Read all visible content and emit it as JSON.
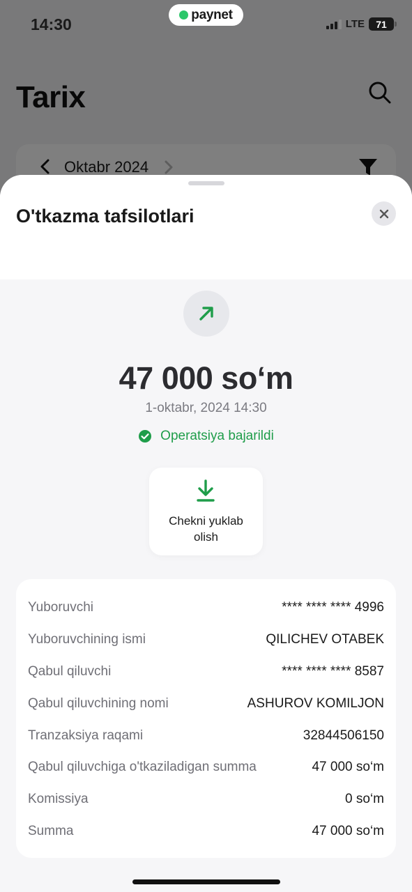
{
  "status_bar": {
    "time": "14:30",
    "brand": "paynet",
    "network": "LTE",
    "battery": "71"
  },
  "background_page": {
    "title": "Tarix",
    "month": "Oktabr 2024"
  },
  "sheet": {
    "title": "O'tkazma tafsilotlari",
    "amount": "47 000 so‘m",
    "datetime": "1-oktabr, 2024 14:30",
    "status": "Operatsiya bajarildi",
    "download_label": "Chekni yuklab olish",
    "details": [
      {
        "label": "Yuboruvchi",
        "value": "**** **** **** 4996"
      },
      {
        "label": "Yuboruvchining ismi",
        "value": "QILICHEV OTABEK"
      },
      {
        "label": "Qabul qiluvchi",
        "value": "**** **** **** 8587"
      },
      {
        "label": "Qabul qiluvchining nomi",
        "value": "ASHUROV KOMILJON"
      },
      {
        "label": "Tranzaksiya raqami",
        "value": "32844506150"
      },
      {
        "label": "Qabul qiluvchiga o'tkaziladigan summa",
        "value": "47 000 so‘m"
      },
      {
        "label": "Komissiya",
        "value": "0 so‘m"
      },
      {
        "label": "Summa",
        "value": "47 000 so‘m"
      }
    ]
  },
  "colors": {
    "accent_green": "#1f9d4a",
    "brand_dot": "#2cc76a"
  },
  "icons": [
    "search-icon",
    "chevron-left-icon",
    "chevron-right-icon",
    "filter-icon",
    "close-icon",
    "arrow-up-right-icon",
    "check-circle-icon",
    "download-icon"
  ]
}
